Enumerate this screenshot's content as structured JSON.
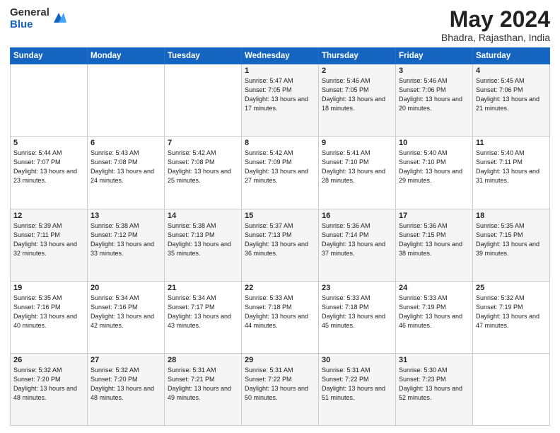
{
  "logo": {
    "general": "General",
    "blue": "Blue"
  },
  "title": "May 2024",
  "location": "Bhadra, Rajasthan, India",
  "days_of_week": [
    "Sunday",
    "Monday",
    "Tuesday",
    "Wednesday",
    "Thursday",
    "Friday",
    "Saturday"
  ],
  "weeks": [
    [
      {
        "day": "",
        "sunrise": "",
        "sunset": "",
        "daylight": ""
      },
      {
        "day": "",
        "sunrise": "",
        "sunset": "",
        "daylight": ""
      },
      {
        "day": "",
        "sunrise": "",
        "sunset": "",
        "daylight": ""
      },
      {
        "day": "1",
        "sunrise": "Sunrise: 5:47 AM",
        "sunset": "Sunset: 7:05 PM",
        "daylight": "Daylight: 13 hours and 17 minutes."
      },
      {
        "day": "2",
        "sunrise": "Sunrise: 5:46 AM",
        "sunset": "Sunset: 7:05 PM",
        "daylight": "Daylight: 13 hours and 18 minutes."
      },
      {
        "day": "3",
        "sunrise": "Sunrise: 5:46 AM",
        "sunset": "Sunset: 7:06 PM",
        "daylight": "Daylight: 13 hours and 20 minutes."
      },
      {
        "day": "4",
        "sunrise": "Sunrise: 5:45 AM",
        "sunset": "Sunset: 7:06 PM",
        "daylight": "Daylight: 13 hours and 21 minutes."
      }
    ],
    [
      {
        "day": "5",
        "sunrise": "Sunrise: 5:44 AM",
        "sunset": "Sunset: 7:07 PM",
        "daylight": "Daylight: 13 hours and 23 minutes."
      },
      {
        "day": "6",
        "sunrise": "Sunrise: 5:43 AM",
        "sunset": "Sunset: 7:08 PM",
        "daylight": "Daylight: 13 hours and 24 minutes."
      },
      {
        "day": "7",
        "sunrise": "Sunrise: 5:42 AM",
        "sunset": "Sunset: 7:08 PM",
        "daylight": "Daylight: 13 hours and 25 minutes."
      },
      {
        "day": "8",
        "sunrise": "Sunrise: 5:42 AM",
        "sunset": "Sunset: 7:09 PM",
        "daylight": "Daylight: 13 hours and 27 minutes."
      },
      {
        "day": "9",
        "sunrise": "Sunrise: 5:41 AM",
        "sunset": "Sunset: 7:10 PM",
        "daylight": "Daylight: 13 hours and 28 minutes."
      },
      {
        "day": "10",
        "sunrise": "Sunrise: 5:40 AM",
        "sunset": "Sunset: 7:10 PM",
        "daylight": "Daylight: 13 hours and 29 minutes."
      },
      {
        "day": "11",
        "sunrise": "Sunrise: 5:40 AM",
        "sunset": "Sunset: 7:11 PM",
        "daylight": "Daylight: 13 hours and 31 minutes."
      }
    ],
    [
      {
        "day": "12",
        "sunrise": "Sunrise: 5:39 AM",
        "sunset": "Sunset: 7:11 PM",
        "daylight": "Daylight: 13 hours and 32 minutes."
      },
      {
        "day": "13",
        "sunrise": "Sunrise: 5:38 AM",
        "sunset": "Sunset: 7:12 PM",
        "daylight": "Daylight: 13 hours and 33 minutes."
      },
      {
        "day": "14",
        "sunrise": "Sunrise: 5:38 AM",
        "sunset": "Sunset: 7:13 PM",
        "daylight": "Daylight: 13 hours and 35 minutes."
      },
      {
        "day": "15",
        "sunrise": "Sunrise: 5:37 AM",
        "sunset": "Sunset: 7:13 PM",
        "daylight": "Daylight: 13 hours and 36 minutes."
      },
      {
        "day": "16",
        "sunrise": "Sunrise: 5:36 AM",
        "sunset": "Sunset: 7:14 PM",
        "daylight": "Daylight: 13 hours and 37 minutes."
      },
      {
        "day": "17",
        "sunrise": "Sunrise: 5:36 AM",
        "sunset": "Sunset: 7:15 PM",
        "daylight": "Daylight: 13 hours and 38 minutes."
      },
      {
        "day": "18",
        "sunrise": "Sunrise: 5:35 AM",
        "sunset": "Sunset: 7:15 PM",
        "daylight": "Daylight: 13 hours and 39 minutes."
      }
    ],
    [
      {
        "day": "19",
        "sunrise": "Sunrise: 5:35 AM",
        "sunset": "Sunset: 7:16 PM",
        "daylight": "Daylight: 13 hours and 40 minutes."
      },
      {
        "day": "20",
        "sunrise": "Sunrise: 5:34 AM",
        "sunset": "Sunset: 7:16 PM",
        "daylight": "Daylight: 13 hours and 42 minutes."
      },
      {
        "day": "21",
        "sunrise": "Sunrise: 5:34 AM",
        "sunset": "Sunset: 7:17 PM",
        "daylight": "Daylight: 13 hours and 43 minutes."
      },
      {
        "day": "22",
        "sunrise": "Sunrise: 5:33 AM",
        "sunset": "Sunset: 7:18 PM",
        "daylight": "Daylight: 13 hours and 44 minutes."
      },
      {
        "day": "23",
        "sunrise": "Sunrise: 5:33 AM",
        "sunset": "Sunset: 7:18 PM",
        "daylight": "Daylight: 13 hours and 45 minutes."
      },
      {
        "day": "24",
        "sunrise": "Sunrise: 5:33 AM",
        "sunset": "Sunset: 7:19 PM",
        "daylight": "Daylight: 13 hours and 46 minutes."
      },
      {
        "day": "25",
        "sunrise": "Sunrise: 5:32 AM",
        "sunset": "Sunset: 7:19 PM",
        "daylight": "Daylight: 13 hours and 47 minutes."
      }
    ],
    [
      {
        "day": "26",
        "sunrise": "Sunrise: 5:32 AM",
        "sunset": "Sunset: 7:20 PM",
        "daylight": "Daylight: 13 hours and 48 minutes."
      },
      {
        "day": "27",
        "sunrise": "Sunrise: 5:32 AM",
        "sunset": "Sunset: 7:20 PM",
        "daylight": "Daylight: 13 hours and 48 minutes."
      },
      {
        "day": "28",
        "sunrise": "Sunrise: 5:31 AM",
        "sunset": "Sunset: 7:21 PM",
        "daylight": "Daylight: 13 hours and 49 minutes."
      },
      {
        "day": "29",
        "sunrise": "Sunrise: 5:31 AM",
        "sunset": "Sunset: 7:22 PM",
        "daylight": "Daylight: 13 hours and 50 minutes."
      },
      {
        "day": "30",
        "sunrise": "Sunrise: 5:31 AM",
        "sunset": "Sunset: 7:22 PM",
        "daylight": "Daylight: 13 hours and 51 minutes."
      },
      {
        "day": "31",
        "sunrise": "Sunrise: 5:30 AM",
        "sunset": "Sunset: 7:23 PM",
        "daylight": "Daylight: 13 hours and 52 minutes."
      },
      {
        "day": "",
        "sunrise": "",
        "sunset": "",
        "daylight": ""
      }
    ]
  ]
}
